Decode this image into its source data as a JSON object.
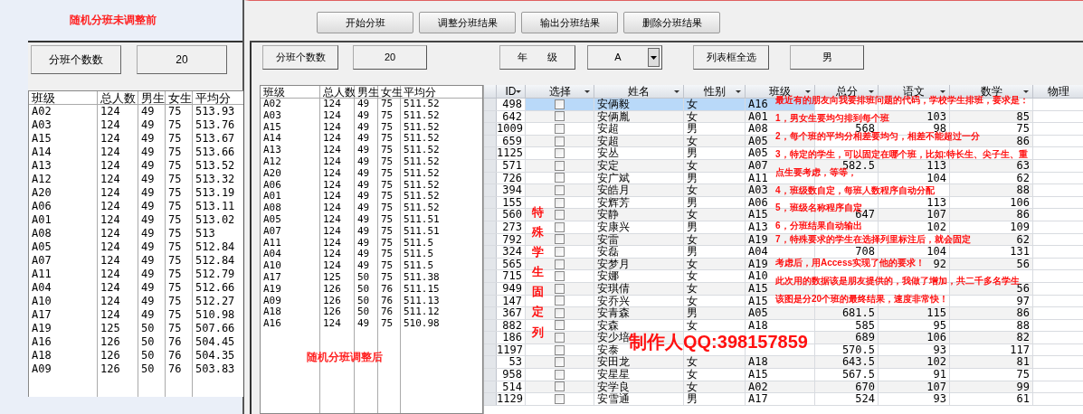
{
  "left_panel": {
    "title": "随机分班未调整前",
    "count_button": "分班个数数",
    "count_value": "20",
    "table": {
      "columns": [
        "班级",
        "总人数",
        "男生",
        "女生",
        "平均分"
      ],
      "rows": [
        [
          "A02",
          "124",
          "49",
          "75",
          "513.93"
        ],
        [
          "A03",
          "124",
          "49",
          "75",
          "513.76"
        ],
        [
          "A15",
          "124",
          "49",
          "75",
          "513.67"
        ],
        [
          "A14",
          "124",
          "49",
          "75",
          "513.66"
        ],
        [
          "A13",
          "124",
          "49",
          "75",
          "513.52"
        ],
        [
          "A12",
          "124",
          "49",
          "75",
          "513.32"
        ],
        [
          "A20",
          "124",
          "49",
          "75",
          "513.19"
        ],
        [
          "A06",
          "124",
          "49",
          "75",
          "513.11"
        ],
        [
          "A01",
          "124",
          "49",
          "75",
          "513.02"
        ],
        [
          "A08",
          "124",
          "49",
          "75",
          "513"
        ],
        [
          "A05",
          "124",
          "49",
          "75",
          "512.84"
        ],
        [
          "A07",
          "124",
          "49",
          "75",
          "512.84"
        ],
        [
          "A11",
          "124",
          "49",
          "75",
          "512.79"
        ],
        [
          "A04",
          "124",
          "49",
          "75",
          "512.66"
        ],
        [
          "A10",
          "124",
          "49",
          "75",
          "512.27"
        ],
        [
          "A17",
          "124",
          "49",
          "75",
          "510.98"
        ],
        [
          "A19",
          "125",
          "50",
          "75",
          "507.66"
        ],
        [
          "A16",
          "126",
          "50",
          "76",
          "504.45"
        ],
        [
          "A18",
          "126",
          "50",
          "76",
          "504.35"
        ],
        [
          "A09",
          "126",
          "50",
          "76",
          "503.83"
        ]
      ]
    }
  },
  "main_window": {
    "top_buttons": [
      "开始分班",
      "调整分班结果",
      "输出分班结果",
      "删除分班结果"
    ],
    "toolbar": {
      "count_button": "分班个数数",
      "count_value": "20",
      "grade_button": "年　　级",
      "grade_combo": "A",
      "select_all_button": "列表框全选",
      "gender_value": "男"
    },
    "summary_list": {
      "columns": [
        "班级",
        "总人数",
        "男生",
        "女生",
        "平均分"
      ],
      "rows": [
        [
          "A02",
          "124",
          "49",
          "75",
          "511.52"
        ],
        [
          "A03",
          "124",
          "49",
          "75",
          "511.52"
        ],
        [
          "A15",
          "124",
          "49",
          "75",
          "511.52"
        ],
        [
          "A14",
          "124",
          "49",
          "75",
          "511.52"
        ],
        [
          "A13",
          "124",
          "49",
          "75",
          "511.52"
        ],
        [
          "A12",
          "124",
          "49",
          "75",
          "511.52"
        ],
        [
          "A20",
          "124",
          "49",
          "75",
          "511.52"
        ],
        [
          "A06",
          "124",
          "49",
          "75",
          "511.52"
        ],
        [
          "A01",
          "124",
          "49",
          "75",
          "511.52"
        ],
        [
          "A08",
          "124",
          "49",
          "75",
          "511.52"
        ],
        [
          "A05",
          "124",
          "49",
          "75",
          "511.51"
        ],
        [
          "A07",
          "124",
          "49",
          "75",
          "511.51"
        ],
        [
          "A11",
          "124",
          "49",
          "75",
          "511.5"
        ],
        [
          "A04",
          "124",
          "49",
          "75",
          "511.5"
        ],
        [
          "A10",
          "124",
          "49",
          "75",
          "511.5"
        ],
        [
          "A17",
          "125",
          "50",
          "75",
          "511.38"
        ],
        [
          "A19",
          "126",
          "50",
          "76",
          "511.15"
        ],
        [
          "A09",
          "126",
          "50",
          "76",
          "511.13"
        ],
        [
          "A18",
          "126",
          "50",
          "76",
          "511.12"
        ],
        [
          "A16",
          "124",
          "49",
          "75",
          "510.98"
        ]
      ]
    },
    "summary_caption": "随机分班调整后",
    "grid": {
      "columns": [
        {
          "label": "ID",
          "filter": true
        },
        {
          "label": "选择",
          "filter": true
        },
        {
          "label": "姓名",
          "filter": true
        },
        {
          "label": "性别",
          "filter": true
        },
        {
          "label": "班级",
          "filter": true
        },
        {
          "label": "总分",
          "filter": true
        },
        {
          "label": "语文",
          "filter": true
        },
        {
          "label": "数学",
          "filter": true
        },
        {
          "label": "物理",
          "filter": false
        }
      ],
      "rows": [
        {
          "selected": true,
          "checked": false,
          "id": "498",
          "name": "安俩毅",
          "gender": "女",
          "class_name": "A16"
        },
        {
          "selected": false,
          "checked": false,
          "id": "642",
          "name": "安俩胤",
          "gender": "女",
          "class_name": "A01",
          "chinese": "103",
          "math": "85"
        },
        {
          "selected": false,
          "checked": false,
          "id": "1009",
          "name": "安超",
          "gender": "男",
          "class_name": "A08",
          "total": "568",
          "chinese": "98",
          "math": "75"
        },
        {
          "selected": false,
          "checked": false,
          "id": "659",
          "name": "安超",
          "gender": "女",
          "class_name": "A05",
          "math": "86"
        },
        {
          "selected": false,
          "checked": false,
          "id": "1125",
          "name": "安丛",
          "gender": "男",
          "class_name": "A05"
        },
        {
          "selected": false,
          "checked": false,
          "id": "571",
          "name": "安定",
          "gender": "女",
          "class_name": "A07",
          "total": "582.5",
          "chinese": "113",
          "math": "63"
        },
        {
          "selected": false,
          "checked": false,
          "id": "726",
          "name": "安广斌",
          "gender": "男",
          "class_name": "A11",
          "chinese": "104",
          "math": "62"
        },
        {
          "selected": false,
          "checked": false,
          "id": "394",
          "name": "安皓月",
          "gender": "女",
          "class_name": "A03",
          "math": "88"
        },
        {
          "selected": false,
          "checked": false,
          "id": "155",
          "name": "安辉芳",
          "gender": "男",
          "class_name": "A06",
          "chinese": "113",
          "math": "106"
        },
        {
          "selected": false,
          "checked": false,
          "id": "560",
          "name": "安静",
          "gender": "女",
          "class_name": "A15",
          "total": "647",
          "chinese": "107",
          "math": "86"
        },
        {
          "selected": false,
          "checked": false,
          "id": "273",
          "name": "安康兴",
          "gender": "男",
          "class_name": "A13",
          "chinese": "102",
          "math": "109"
        },
        {
          "selected": false,
          "checked": false,
          "id": "792",
          "name": "安雷",
          "gender": "女",
          "class_name": "A19",
          "math": "62"
        },
        {
          "selected": false,
          "checked": false,
          "id": "324",
          "name": "安磊",
          "gender": "男",
          "class_name": "A04",
          "total": "708",
          "chinese": "104",
          "math": "131"
        },
        {
          "selected": false,
          "checked": false,
          "id": "565",
          "name": "安梦月",
          "gender": "女",
          "class_name": "A19",
          "chinese": "92",
          "math": "56"
        },
        {
          "selected": false,
          "checked": false,
          "id": "715",
          "name": "安娜",
          "gender": "女",
          "class_name": "A10"
        },
        {
          "selected": false,
          "checked": false,
          "id": "949",
          "name": "安琪倩",
          "gender": "女",
          "class_name": "A15",
          "math": "56"
        },
        {
          "selected": false,
          "checked": false,
          "id": "147",
          "name": "安乔兴",
          "gender": "女",
          "class_name": "A15",
          "math": "97"
        },
        {
          "selected": false,
          "checked": false,
          "id": "367",
          "name": "安青森",
          "gender": "男",
          "class_name": "A05",
          "total": "681.5",
          "chinese": "115",
          "math": "86"
        },
        {
          "selected": false,
          "checked": false,
          "id": "882",
          "name": "安森",
          "gender": "女",
          "class_name": "A18",
          "total": "585",
          "chinese": "95",
          "math": "88"
        },
        {
          "selected": false,
          "checked": false,
          "id": "186",
          "name": "安少培",
          "total": "689",
          "chinese": "106",
          "math": "82"
        },
        {
          "selected": false,
          "checked": false,
          "id": "1197",
          "name": "安泰",
          "total": "570.5",
          "chinese": "93",
          "math": "117"
        },
        {
          "selected": false,
          "checked": false,
          "id": "53",
          "name": "安田龙",
          "gender": "女",
          "class_name": "A18",
          "total": "643.5",
          "chinese": "102",
          "math": "81"
        },
        {
          "selected": false,
          "checked": false,
          "id": "958",
          "name": "安星星",
          "gender": "女",
          "class_name": "A15",
          "total": "567.5",
          "chinese": "91",
          "math": "75"
        },
        {
          "selected": false,
          "checked": false,
          "id": "514",
          "name": "安学良",
          "gender": "女",
          "class_name": "A02",
          "total": "670",
          "chinese": "107",
          "math": "99"
        },
        {
          "selected": false,
          "checked": false,
          "id": "1129",
          "name": "安雪通",
          "gender": "男",
          "class_name": "A17",
          "total": "524",
          "chinese": "93",
          "math": "61"
        }
      ]
    },
    "annotations": {
      "vertical_label": "特殊学生固定列",
      "author": "制作人QQ:398157859",
      "lines": [
        "最近有的朋友向我要排班问题的代码，学校学生排班，要求是：",
        "1，男女生要均匀排到每个班",
        "2，每个班的平均分相差要均匀，相差不能超过一分",
        "3，特定的学生，可以固定在哪个班，比如:特长生、尖子生、重",
        "点生要考虑，等等，",
        "4，班级数自定，每班人数程序自动分配",
        "5，班级名称程序自定",
        "6，分班结果自动输出",
        "7，特殊要求的学生在选择列里标注后，就会固定",
        "考虑后，用Access实现了他的要求！",
        "此次用的数据该是朋友提供的，我做了增加，共二千多名学生",
        "该图是分20个班的最终结果，速度非常快！"
      ]
    }
  }
}
